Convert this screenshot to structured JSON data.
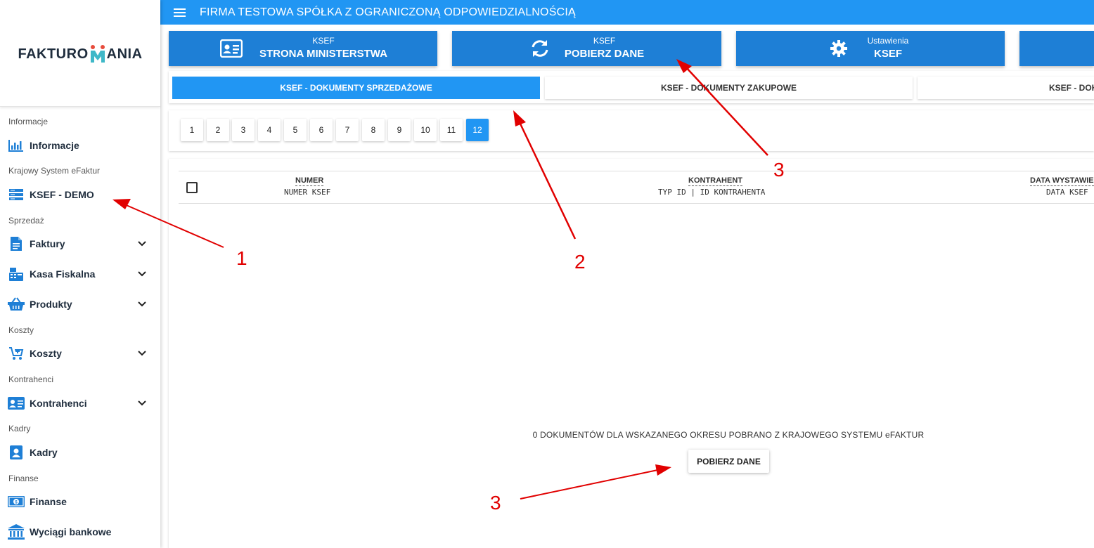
{
  "logo": {
    "text_left": "FAKTURO",
    "text_right": "ANIA"
  },
  "header": {
    "title": "FIRMA TESTOWA SPÓŁKA Z OGRANICZONĄ ODPOWIEDZIALNOŚCIĄ"
  },
  "sidebar": {
    "sections": {
      "informacje": "Informacje",
      "ksef": "Krajowy System eFaktur",
      "sprzedaz": "Sprzedaż",
      "koszty": "Koszty",
      "kontrahenci": "Kontrahenci",
      "kadry": "Kadry",
      "finanse": "Finanse"
    },
    "items": {
      "informacje": "Informacje",
      "ksef_demo": "KSEF - DEMO",
      "faktury": "Faktury",
      "kasa": "Kasa Fiskalna",
      "produkty": "Produkty",
      "koszty": "Koszty",
      "kontrahenci": "Kontrahenci",
      "kadry": "Kadry",
      "finanse": "Finanse",
      "wyciagi": "Wyciągi bankowe"
    }
  },
  "actions": [
    {
      "sub": "KSEF",
      "main": "STRONA MINISTERSTWA",
      "icon": "id-card-icon"
    },
    {
      "sub": "KSEF",
      "main": "POBIERZ DANE",
      "icon": "sync-icon"
    },
    {
      "sub": "Ustawienia",
      "main": "KSEF",
      "icon": "gear-icon"
    }
  ],
  "tabs": [
    "KSEF - DOKUMENTY SPRZEDAŻOWE",
    "KSEF - DOKUMENTY ZAKUPOWE",
    "KSEF - DOK"
  ],
  "pagination": {
    "pages": [
      "1",
      "2",
      "3",
      "4",
      "5",
      "6",
      "7",
      "8",
      "9",
      "10",
      "11",
      "12"
    ],
    "active": "12"
  },
  "table": {
    "columns": [
      {
        "title": "NUMER",
        "sub": "NUMER KSEF"
      },
      {
        "title": "KONTRAHENT",
        "sub": "TYP ID | ID KONTRAHENTA"
      },
      {
        "title": "DATA WYSTAWIE",
        "sub": "DATA KSEF"
      }
    ],
    "empty_message": "0 DOKUMENTÓW DLA WSKAZANEGO OKRESU POBRANO Z KRAJOWEGO SYSTEMU eFAKTUR",
    "fetch_button": "POBIERZ DANE"
  },
  "annotations": {
    "n1": "1",
    "n2": "2",
    "n3a": "3",
    "n3b": "3",
    "color": "#e10000"
  },
  "colors": {
    "primary": "#2196f3",
    "action_card": "#1e7fd6",
    "text": "#1f2d3d",
    "logo_accent": "#e74c3c",
    "logo_teal": "#3fb8c8"
  }
}
